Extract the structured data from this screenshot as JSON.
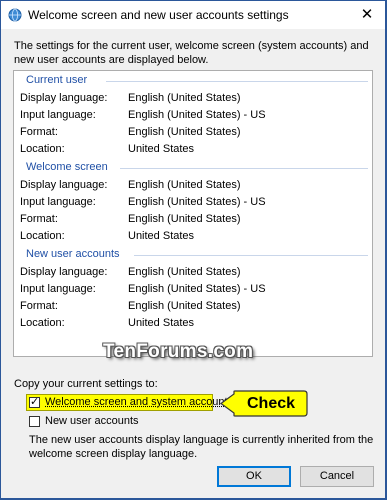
{
  "window": {
    "title": "Welcome screen and new user accounts settings",
    "close_glyph": "✕",
    "description": "The settings for the current user, welcome screen (system accounts) and new user accounts are displayed below."
  },
  "groups": [
    {
      "heading": "Current user",
      "rows": [
        {
          "label": "Display language:",
          "value": "English (United States)"
        },
        {
          "label": "Input language:",
          "value": "English (United States) - US"
        },
        {
          "label": "Format:",
          "value": "English (United States)"
        },
        {
          "label": "Location:",
          "value": "United States"
        }
      ]
    },
    {
      "heading": "Welcome screen",
      "rows": [
        {
          "label": "Display language:",
          "value": "English (United States)"
        },
        {
          "label": "Input language:",
          "value": "English (United States) - US"
        },
        {
          "label": "Format:",
          "value": "English (United States)"
        },
        {
          "label": "Location:",
          "value": "United States"
        }
      ]
    },
    {
      "heading": "New user accounts",
      "rows": [
        {
          "label": "Display language:",
          "value": "English (United States)"
        },
        {
          "label": "Input language:",
          "value": "English (United States) - US"
        },
        {
          "label": "Format:",
          "value": "English (United States)"
        },
        {
          "label": "Location:",
          "value": "United States"
        }
      ]
    }
  ],
  "watermark": "TenForums.com",
  "copy": {
    "label": "Copy your current settings to:",
    "welcome_checkbox": {
      "label": "Welcome screen and system accounts",
      "checked": true,
      "check_glyph": "✓"
    },
    "new_users_checkbox": {
      "label": "New user accounts",
      "checked": false
    },
    "note": "The new user accounts display language is currently inherited from the welcome screen display language."
  },
  "annotation": {
    "callout": "Check",
    "highlight_color": "#ffff00"
  },
  "buttons": {
    "ok": "OK",
    "cancel": "Cancel"
  },
  "colors": {
    "accent": "#2b579a",
    "group_heading": "#2050a6",
    "focus": "#0078d7"
  }
}
